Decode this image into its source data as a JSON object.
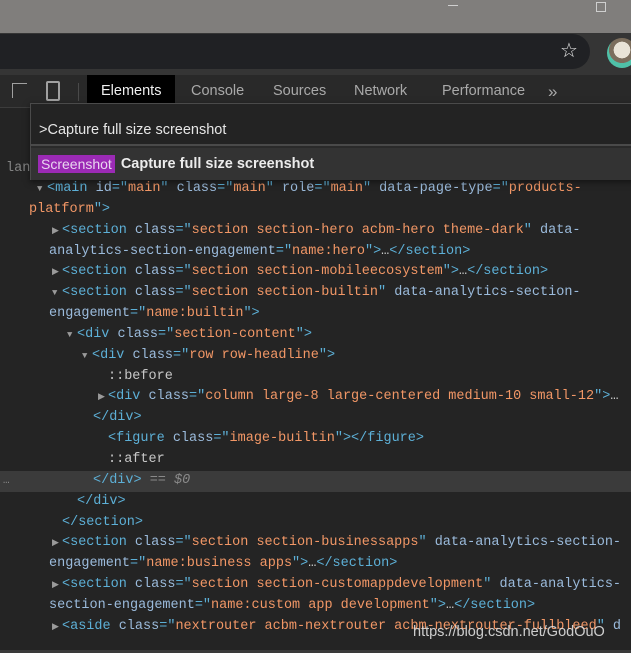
{
  "window": {
    "minimize_icon": "minimize-icon",
    "restore_icon": "restore-icon"
  },
  "browser": {
    "bookmark_icon": "star-icon",
    "star": "☆"
  },
  "devtools": {
    "tabs": [
      {
        "label": "Elements",
        "active": true
      },
      {
        "label": "Console"
      },
      {
        "label": "Sources"
      },
      {
        "label": "Network"
      },
      {
        "label": "Performance"
      }
    ],
    "more_tabs": "»"
  },
  "command_palette": {
    "input_value": ">Capture full size screenshot",
    "results": [
      {
        "category": "Screenshot",
        "title": "Capture full size screenshot"
      }
    ],
    "category_color": "#9b2ab5"
  },
  "dom_tree": [
    {
      "indent": 6,
      "segs": [
        [
          "text",
          "landscape\":retina\":false}\"></div>"
        ]
      ]
    },
    {
      "indent": 47,
      "arrow": "down",
      "segs": [
        [
          "tag",
          "<main "
        ],
        [
          "attr",
          "id"
        ],
        [
          "tag",
          "=\""
        ],
        [
          "val",
          "main"
        ],
        [
          "tag",
          "\" "
        ],
        [
          "attr",
          "class"
        ],
        [
          "tag",
          "=\""
        ],
        [
          "val",
          "main"
        ],
        [
          "tag",
          "\" "
        ],
        [
          "attr",
          "role"
        ],
        [
          "tag",
          "=\""
        ],
        [
          "val",
          "main"
        ],
        [
          "tag",
          "\" "
        ],
        [
          "attr",
          "data-page-type"
        ],
        [
          "tag",
          "=\""
        ],
        [
          "val",
          "products-"
        ]
      ]
    },
    {
      "indent": 29,
      "segs": [
        [
          "val",
          "platform"
        ],
        [
          "tag",
          "\">"
        ]
      ]
    },
    {
      "indent": 62,
      "arrow": "right",
      "segs": [
        [
          "tag",
          "<section "
        ],
        [
          "attr",
          "class"
        ],
        [
          "tag",
          "=\""
        ],
        [
          "val",
          "section section-hero acbm-hero theme-dark"
        ],
        [
          "tag",
          "\" "
        ],
        [
          "attr",
          "data-"
        ]
      ]
    },
    {
      "indent": 49,
      "segs": [
        [
          "attr",
          "analytics-section-engagement"
        ],
        [
          "tag",
          "=\""
        ],
        [
          "val",
          "name:hero"
        ],
        [
          "tag",
          "\">"
        ],
        [
          "text",
          "…"
        ],
        [
          "tag",
          "</section>"
        ]
      ]
    },
    {
      "indent": 62,
      "arrow": "right",
      "segs": [
        [
          "tag",
          "<section "
        ],
        [
          "attr",
          "class"
        ],
        [
          "tag",
          "=\""
        ],
        [
          "val",
          "section section-mobileecosystem"
        ],
        [
          "tag",
          "\">"
        ],
        [
          "text",
          "…"
        ],
        [
          "tag",
          "</section>"
        ]
      ]
    },
    {
      "indent": 62,
      "arrow": "down",
      "segs": [
        [
          "tag",
          "<section "
        ],
        [
          "attr",
          "class"
        ],
        [
          "tag",
          "=\""
        ],
        [
          "val",
          "section section-builtin"
        ],
        [
          "tag",
          "\" "
        ],
        [
          "attr",
          "data-analytics-section-"
        ]
      ]
    },
    {
      "indent": 49,
      "segs": [
        [
          "attr",
          "engagement"
        ],
        [
          "tag",
          "=\""
        ],
        [
          "val",
          "name:builtin"
        ],
        [
          "tag",
          "\">"
        ]
      ]
    },
    {
      "indent": 77,
      "arrow": "down",
      "segs": [
        [
          "tag",
          "<div "
        ],
        [
          "attr",
          "class"
        ],
        [
          "tag",
          "=\""
        ],
        [
          "val",
          "section-content"
        ],
        [
          "tag",
          "\">"
        ]
      ]
    },
    {
      "indent": 92,
      "arrow": "down",
      "segs": [
        [
          "tag",
          "<div "
        ],
        [
          "attr",
          "class"
        ],
        [
          "tag",
          "=\""
        ],
        [
          "val",
          "row row-headline"
        ],
        [
          "tag",
          "\">"
        ]
      ]
    },
    {
      "indent": 108,
      "segs": [
        [
          "pseudo",
          "::before"
        ]
      ]
    },
    {
      "indent": 108,
      "arrow": "right",
      "segs": [
        [
          "tag",
          "<div "
        ],
        [
          "attr",
          "class"
        ],
        [
          "tag",
          "=\""
        ],
        [
          "val",
          "column large-8 large-centered medium-10 small-12"
        ],
        [
          "tag",
          "\">"
        ],
        [
          "text",
          "…"
        ]
      ]
    },
    {
      "indent": 93,
      "segs": [
        [
          "tag",
          "</div>"
        ]
      ]
    },
    {
      "indent": 108,
      "segs": [
        [
          "tag",
          "<figure "
        ],
        [
          "attr",
          "class"
        ],
        [
          "tag",
          "=\""
        ],
        [
          "val",
          "image-builtin"
        ],
        [
          "tag",
          "\"></figure>"
        ]
      ]
    },
    {
      "indent": 108,
      "segs": [
        [
          "pseudo",
          "::after"
        ]
      ]
    },
    {
      "indent": 93,
      "selected": true,
      "segs": [
        [
          "tag",
          "</div>"
        ],
        [
          "dollar",
          " == $0"
        ]
      ]
    },
    {
      "indent": 77,
      "segs": [
        [
          "tag",
          "</div>"
        ]
      ]
    },
    {
      "indent": 62,
      "segs": [
        [
          "tag",
          "</section>"
        ]
      ]
    },
    {
      "indent": 62,
      "arrow": "right",
      "segs": [
        [
          "tag",
          "<section "
        ],
        [
          "attr",
          "class"
        ],
        [
          "tag",
          "=\""
        ],
        [
          "val",
          "section section-businessapps"
        ],
        [
          "tag",
          "\" "
        ],
        [
          "attr",
          "data-analytics-section-"
        ]
      ]
    },
    {
      "indent": 49,
      "segs": [
        [
          "attr",
          "engagement"
        ],
        [
          "tag",
          "=\""
        ],
        [
          "val",
          "name:business apps"
        ],
        [
          "tag",
          "\">"
        ],
        [
          "text",
          "…"
        ],
        [
          "tag",
          "</section>"
        ]
      ]
    },
    {
      "indent": 62,
      "arrow": "right",
      "segs": [
        [
          "tag",
          "<section "
        ],
        [
          "attr",
          "class"
        ],
        [
          "tag",
          "=\""
        ],
        [
          "val",
          "section section-customappdevelopment"
        ],
        [
          "tag",
          "\" "
        ],
        [
          "attr",
          "data-analytics-"
        ]
      ]
    },
    {
      "indent": 49,
      "segs": [
        [
          "attr",
          "section-engagement"
        ],
        [
          "tag",
          "=\""
        ],
        [
          "val",
          "name:custom app development"
        ],
        [
          "tag",
          "\">"
        ],
        [
          "text",
          "…"
        ],
        [
          "tag",
          "</section>"
        ]
      ]
    },
    {
      "indent": 62,
      "arrow": "right",
      "segs": [
        [
          "tag",
          "<aside "
        ],
        [
          "attr",
          "class"
        ],
        [
          "tag",
          "=\""
        ],
        [
          "val",
          "nextrouter acbm-nextrouter acbm-nextrouter-fullbleed"
        ],
        [
          "tag",
          "\" "
        ],
        [
          "attr",
          "d"
        ]
      ]
    }
  ],
  "selected_row_menu": "…",
  "watermark": "https://blog.csdn.net/GodOuO",
  "colors": {
    "tag": "#5db0d7",
    "attr": "#9bbbdc",
    "value": "#f29766",
    "background": "#242424"
  }
}
